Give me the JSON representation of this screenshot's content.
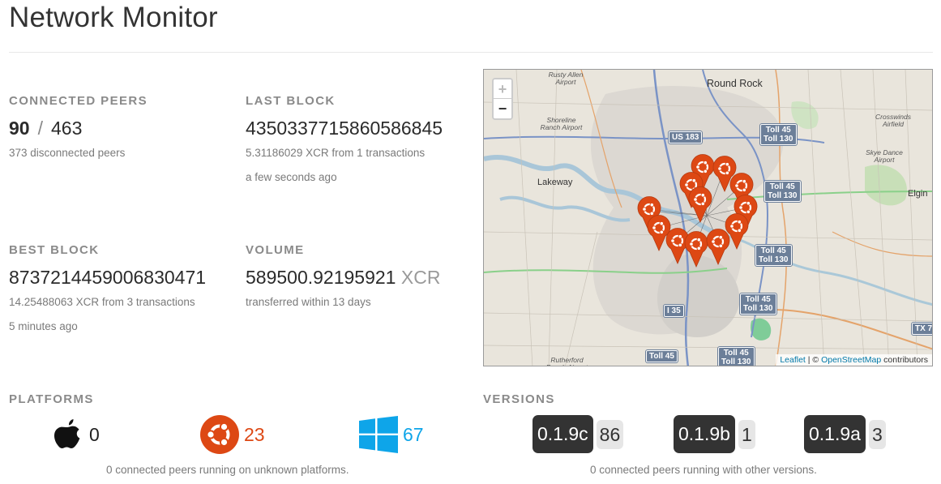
{
  "page": {
    "title": "Network Monitor"
  },
  "stats": {
    "connected_peers": {
      "label": "CONNECTED PEERS",
      "connected": "90",
      "separator": "/",
      "total": "463",
      "sub": "373 disconnected peers"
    },
    "last_block": {
      "label": "LAST BLOCK",
      "value": "4350337715860586845",
      "sub": "5.31186029 XCR from 1 transactions",
      "time": "a few seconds ago"
    },
    "best_block": {
      "label": "BEST BLOCK",
      "value": "8737214459006830471",
      "sub": "14.25488063 XCR from 3 transactions",
      "time": "5 minutes ago"
    },
    "volume": {
      "label": "VOLUME",
      "value": "589500.92195921",
      "unit": "XCR",
      "sub": "transferred within 13 days"
    }
  },
  "map": {
    "zoom_in": "+",
    "zoom_out": "−",
    "attribution": {
      "leaflet": "Leaflet",
      "sep": " | © ",
      "osm": "OpenStreetMap",
      "suffix": " contributors"
    },
    "places": {
      "round_rock": "Round Rock",
      "lakeway": "Lakeway",
      "elgin": "Elgin",
      "rusty_allen": "Rusty Allen Airport",
      "shoreline": "Shoreline Ranch Airport",
      "crosswinds": "Crosswinds Airfield",
      "skye_dance": "Skye Dance Airport",
      "rutherford": "Rutherford Ranch Airport"
    },
    "roads": {
      "us183": "US 183",
      "i35": "I 35",
      "toll45": "Toll 45",
      "toll45_130": [
        "Toll 45",
        "Toll 130"
      ],
      "tx": "TX 7"
    },
    "marker_icon": "ubuntu-icon",
    "marker_color": "#dd4814"
  },
  "platforms": {
    "label": "PLATFORMS",
    "items": [
      {
        "icon": "apple-icon",
        "count": "0",
        "color": "#222222"
      },
      {
        "icon": "ubuntu-icon",
        "count": "23",
        "color": "#dd4814"
      },
      {
        "icon": "windows-icon",
        "count": "67",
        "color": "#0ea5e9"
      }
    ],
    "note": "0 connected peers running on unknown platforms."
  },
  "versions": {
    "label": "VERSIONS",
    "items": [
      {
        "version": "0.1.9c",
        "count": "86"
      },
      {
        "version": "0.1.9b",
        "count": "1"
      },
      {
        "version": "0.1.9a",
        "count": "3"
      }
    ],
    "note": "0 connected peers running with other versions."
  }
}
